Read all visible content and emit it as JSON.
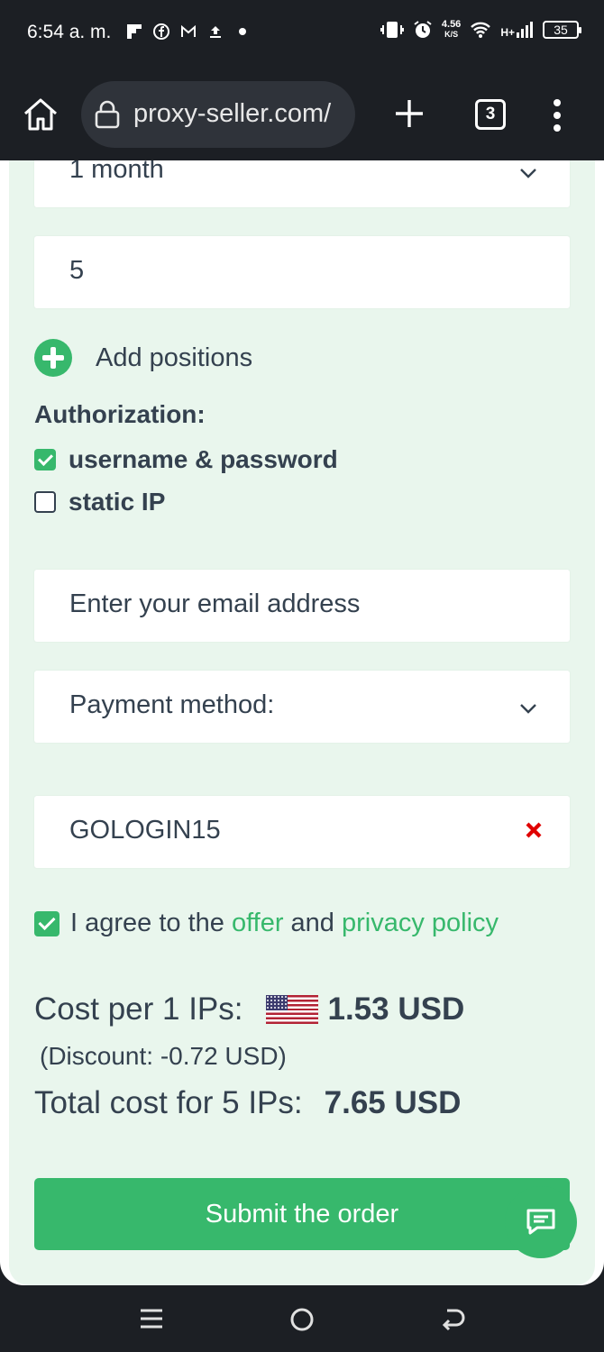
{
  "status_bar": {
    "time": "6:54 a. m.",
    "speed_value": "4.56",
    "speed_unit": "K/S",
    "network": "H+",
    "battery": "35",
    "icons": [
      "flipboard-icon",
      "facebook-icon",
      "gmail-icon",
      "upload-icon",
      "dot-icon",
      "vibrate-icon",
      "alarm-icon",
      "wifi-icon",
      "signal-icon",
      "battery-icon"
    ]
  },
  "browser": {
    "url": "proxy-seller.com/",
    "tab_count": "3",
    "icons": [
      "home-icon",
      "lock-icon",
      "plus-icon",
      "tabs-icon",
      "more-vert-icon"
    ]
  },
  "form": {
    "period_value": "1 month",
    "quantity_value": "5",
    "add_positions_label": "Add positions",
    "authorization_title": "Authorization:",
    "auth_options": [
      {
        "label": "username & password",
        "checked": true
      },
      {
        "label": "static IP",
        "checked": false
      }
    ],
    "email_placeholder": "Enter your email address",
    "payment_placeholder": "Payment method:",
    "coupon_value": "GOLOGIN15",
    "agree": {
      "checked": true,
      "prefix": "I agree to the",
      "offer_link": "offer",
      "and": "and",
      "privacy_link": "privacy policy"
    },
    "cost_per_label": "Cost per 1 IPs:",
    "cost_per_value": "1.53 USD",
    "discount_text": "(Discount: -0.72 USD)",
    "total_label": "Total cost for 5 IPs:",
    "total_value": "7.65 USD",
    "submit_label": "Submit the order"
  },
  "colors": {
    "accent": "#37b86c",
    "panel_bg": "#e9f6ed",
    "text": "#34414f",
    "remove_x": "#e00000"
  }
}
